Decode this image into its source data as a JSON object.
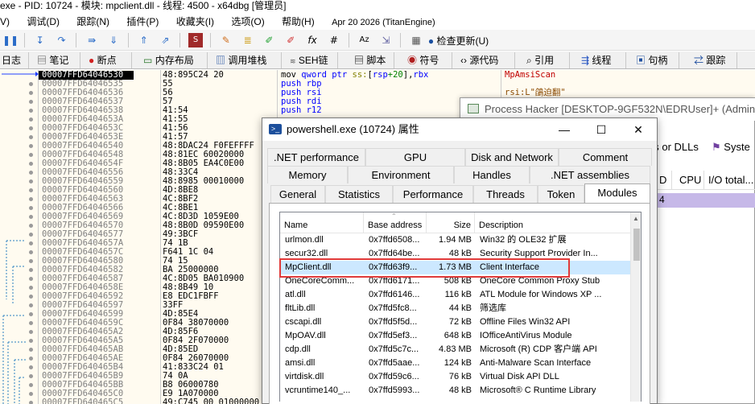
{
  "titlebar": {
    "text": "exe - PID: 10724 - 模块: mpclient.dll - 线程: 4500 - x64dbg [管理员]"
  },
  "menu": {
    "items": [
      "V)",
      "调试(D)",
      "跟踪(N)",
      "插件(P)",
      "收藏夹(I)",
      "选项(O)",
      "帮助(H)",
      "Apr 20 2026 (TitanEngine)"
    ]
  },
  "toolbar": {
    "update_label": "检查更新(U)"
  },
  "tabs": [
    "日志",
    "笔记",
    "断点",
    "内存布局",
    "调用堆栈",
    "SEH链",
    "脚本",
    "符号",
    "源代码",
    "引用",
    "线程",
    "句柄",
    "跟踪"
  ],
  "disasm": {
    "rows": [
      {
        "addr": "00007FFD64046530",
        "bytes": "48:895C24 20",
        "current": true
      },
      {
        "addr": "00007FFD64046535",
        "bytes": "55"
      },
      {
        "addr": "00007FFD64046536",
        "bytes": "56"
      },
      {
        "addr": "00007FFD64046537",
        "bytes": "57"
      },
      {
        "addr": "00007FFD64046538",
        "bytes": "41:54"
      },
      {
        "addr": "00007FFD6404653A",
        "bytes": "41:55"
      },
      {
        "addr": "00007FFD6404653C",
        "bytes": "41:56"
      },
      {
        "addr": "00007FFD6404653E",
        "bytes": "41:57"
      },
      {
        "addr": "00007FFD64046540",
        "bytes": "48:8DAC24 F0FEFFFF"
      },
      {
        "addr": "00007FFD64046548",
        "bytes": "48:81EC 60020000"
      },
      {
        "addr": "00007FFD6404654F",
        "bytes": "48:8B05 EA4C0E00"
      },
      {
        "addr": "00007FFD64046556",
        "bytes": "48:33C4"
      },
      {
        "addr": "00007FFD64046559",
        "bytes": "48:8985 00010000"
      },
      {
        "addr": "00007FFD64046560",
        "bytes": "4D:8BE8"
      },
      {
        "addr": "00007FFD64046563",
        "bytes": "4C:8BF2"
      },
      {
        "addr": "00007FFD64046566",
        "bytes": "4C:8BE1"
      },
      {
        "addr": "00007FFD64046569",
        "bytes": "4C:8D3D 1059E00"
      },
      {
        "addr": "00007FFD64046570",
        "bytes": "48:8B0D 09590E00"
      },
      {
        "addr": "00007FFD64046577",
        "bytes": "49:3BCF"
      },
      {
        "addr": "00007FFD6404657A",
        "bytes": "74 1B",
        "jump": true
      },
      {
        "addr": "00007FFD6404657C",
        "bytes": "F641 1C 04"
      },
      {
        "addr": "00007FFD64046580",
        "bytes": "74 15",
        "jump": true
      },
      {
        "addr": "00007FFD64046582",
        "bytes": "BA 25000000"
      },
      {
        "addr": "00007FFD64046587",
        "bytes": "4C:8D05 BA010900"
      },
      {
        "addr": "00007FFD6404658E",
        "bytes": "48:8B49 10"
      },
      {
        "addr": "00007FFD64046592",
        "bytes": "E8 EDC1FBFF"
      },
      {
        "addr": "00007FFD64046597",
        "bytes": "33FF"
      },
      {
        "addr": "00007FFD64046599",
        "bytes": "4D:85E4"
      },
      {
        "addr": "00007FFD6404659C",
        "bytes": "0F84 38070000",
        "jump": true
      },
      {
        "addr": "00007FFD640465A2",
        "bytes": "4D:85F6"
      },
      {
        "addr": "00007FFD640465A5",
        "bytes": "0F84 2F070000",
        "jump": true
      },
      {
        "addr": "00007FFD640465AB",
        "bytes": "4D:85ED"
      },
      {
        "addr": "00007FFD640465AE",
        "bytes": "0F84 26070000",
        "jump": true
      },
      {
        "addr": "00007FFD640465B4",
        "bytes": "41:833C24 01"
      },
      {
        "addr": "00007FFD640465B9",
        "bytes": "74 0A",
        "jump": true
      },
      {
        "addr": "00007FFD640465BB",
        "bytes": "B8 06000780"
      },
      {
        "addr": "00007FFD640465C0",
        "bytes": "E9 1A070000",
        "jump": true
      },
      {
        "addr": "00007FFD640465C5",
        "bytes": "49:C745 00 01000000"
      }
    ],
    "asm": [
      {
        "mn": "mov",
        "ops": [
          [
            "kw",
            "qword ptr "
          ],
          [
            "seg",
            "ss:"
          ],
          [
            "reg",
            "["
          ],
          [
            "kw",
            "rsp"
          ],
          [
            "num",
            "+20"
          ],
          [
            "reg",
            "],"
          ],
          [
            "kw",
            "rbx"
          ]
        ]
      },
      {
        "mn": "push",
        "ops": [
          [
            "kw",
            "rbp"
          ]
        ]
      },
      {
        "mn": "push",
        "ops": [
          [
            "kw",
            "rsi"
          ]
        ]
      },
      {
        "mn": "push",
        "ops": [
          [
            "kw",
            "rdi"
          ]
        ]
      },
      {
        "mn": "push",
        "ops": [
          [
            "kw",
            "r12"
          ]
        ]
      }
    ],
    "comments": [
      "MpAmsiScan",
      "rsi:L\"鵮迫翻\""
    ]
  },
  "process_hacker": {
    "title": "Process Hacker [DESKTOP-9GF532N\\EDRUser]+ (Administ",
    "tab_fragments": [
      "es or DLLs",
      "Syste"
    ],
    "columns": [
      "D",
      "CPU",
      "I/O total..."
    ],
    "row_value": "4"
  },
  "dialog": {
    "title": "powershell.exe (10724) 属性",
    "tabs_row1": [
      ".NET performance",
      "GPU",
      "Disk and Network",
      "Comment"
    ],
    "tabs_row2": [
      "Memory",
      "Environment",
      "Handles",
      ".NET assemblies"
    ],
    "tabs_row3": [
      "General",
      "Statistics",
      "Performance",
      "Threads",
      "Token",
      "Modules"
    ],
    "active_tab": "Modules",
    "list": {
      "columns": [
        "Name",
        "Base address",
        "Size",
        "Description"
      ],
      "rows": [
        {
          "name": "urlmon.dll",
          "base": "0x7ffd6508...",
          "size": "1.94 MB",
          "desc": "Win32 的 OLE32 扩展"
        },
        {
          "name": "secur32.dll",
          "base": "0x7ffd64be...",
          "size": "48 kB",
          "desc": "Security Support Provider In..."
        },
        {
          "name": "MpClient.dll",
          "base": "0x7ffd63f9...",
          "size": "1.73 MB",
          "desc": "Client Interface",
          "selected": true
        },
        {
          "name": "OneCoreComm...",
          "base": "0x7ffd6171...",
          "size": "508 kB",
          "desc": "OneCore Common Proxy Stub"
        },
        {
          "name": "atl.dll",
          "base": "0x7ffd6146...",
          "size": "116 kB",
          "desc": "ATL Module for Windows XP ..."
        },
        {
          "name": "fltLib.dll",
          "base": "0x7ffd5fc8...",
          "size": "44 kB",
          "desc": "筛选库"
        },
        {
          "name": "cscapi.dll",
          "base": "0x7ffd5f5d...",
          "size": "72 kB",
          "desc": "Offline Files Win32 API"
        },
        {
          "name": "MpOAV.dll",
          "base": "0x7ffd5ef3...",
          "size": "648 kB",
          "desc": "IOfficeAntiVirus Module"
        },
        {
          "name": "cdp.dll",
          "base": "0x7ffd5c7c...",
          "size": "4.83 MB",
          "desc": "Microsoft (R) CDP 客户端 API"
        },
        {
          "name": "amsi.dll",
          "base": "0x7ffd5aae...",
          "size": "124 kB",
          "desc": "Anti-Malware Scan Interface"
        },
        {
          "name": "virtdisk.dll",
          "base": "0x7ffd59c6...",
          "size": "76 kB",
          "desc": "Virtual Disk API DLL"
        },
        {
          "name": "vcruntime140_...",
          "base": "0x7ffd5993...",
          "size": "48 kB",
          "desc": "Microsoft® C Runtime Library"
        }
      ]
    }
  }
}
